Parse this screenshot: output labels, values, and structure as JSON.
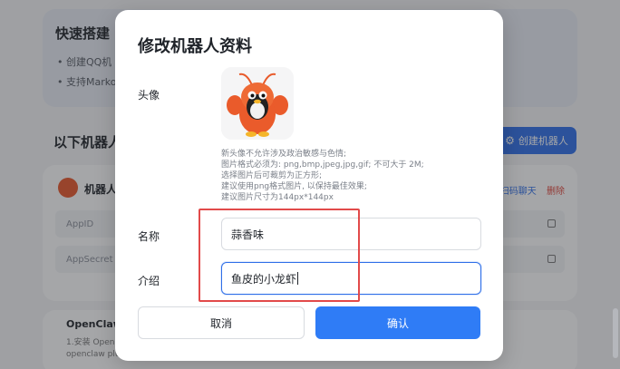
{
  "background": {
    "quick_start": {
      "title": "快速搭建",
      "items": [
        "• 创建QQ机",
        "• 支持Marko"
      ]
    },
    "list_title": "以下机器人",
    "create_button": "创建机器人",
    "bot": {
      "name": "机器人",
      "scan_action": "扫码聊天",
      "delete_action": "删除",
      "fields": [
        {
          "label": "AppID"
        },
        {
          "label": "AppSecret"
        }
      ]
    },
    "openclaw": {
      "title": "OpenClaw",
      "lines": [
        "1.安装 OpenC",
        "openclaw plu"
      ]
    }
  },
  "modal": {
    "title": "修改机器人资料",
    "avatar_label": "头像",
    "avatar_hints": [
      "新头像不允许涉及政治敏感与色情;",
      "图片格式必须为: png,bmp,jpeg,jpg,gif; 不可大于 2M;",
      "选择图片后可裁剪为正方形;",
      "建议使用png格式图片, 以保持最佳效果;",
      "建议图片尺寸为144px*144px"
    ],
    "name_label": "名称",
    "name_value": "蒜香味",
    "intro_label": "介绍",
    "intro_value": "鱼皮的小龙虾",
    "cancel_label": "取消",
    "confirm_label": "确认"
  },
  "colors": {
    "primary": "#2f7cf6",
    "highlight": "#e24a4a",
    "delete": "#e0463b"
  }
}
